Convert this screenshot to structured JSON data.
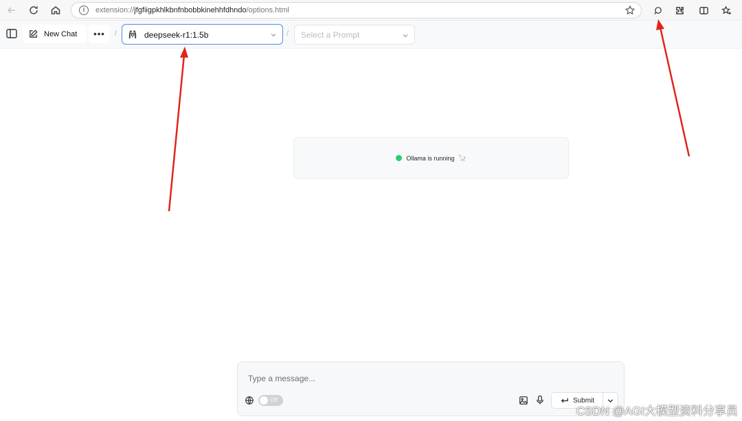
{
  "browser": {
    "url_scheme": "extension://",
    "url_host": "jfgfiigpkhlkbnfnbobbkinehhfdhndo",
    "url_path": "/options.html",
    "icons": [
      "back-icon",
      "reload-icon",
      "home-icon",
      "info-icon",
      "star-icon",
      "chat-extension-icon",
      "extensions-icon",
      "split-screen-icon",
      "favorites-icon"
    ]
  },
  "toolbar": {
    "new_chat_label": "New Chat",
    "more_label": "•••",
    "separator": "/",
    "model_value": "deepseek-r1:1.5b",
    "prompt_placeholder": "Select a Prompt"
  },
  "status": {
    "text": "Ollama is running",
    "indicator_color": "#2ecc71",
    "emoji": "🦙"
  },
  "composer": {
    "placeholder": "Type a message...",
    "web_search_toggle": "Off",
    "submit_label": "Submit"
  },
  "annotation": {
    "arrow_color": "#e0241b"
  },
  "watermark": "CSDN @AGI大模型资料分享员"
}
